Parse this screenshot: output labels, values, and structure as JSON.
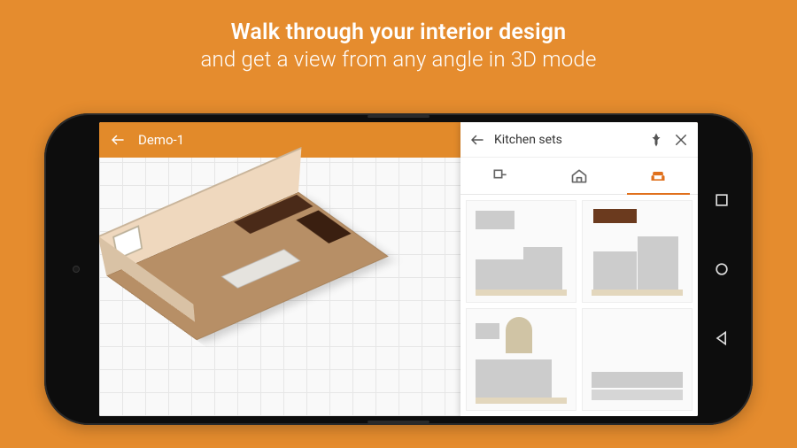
{
  "promo": {
    "line1": "Walk through your interior design",
    "line2": "and get a view from any angle in 3D mode"
  },
  "app": {
    "header": {
      "back_icon": "arrow-left",
      "title": "Demo-1"
    }
  },
  "panel": {
    "header": {
      "back_icon": "arrow-left",
      "title": "Kitchen sets",
      "pin_icon": "pin",
      "close_icon": "close"
    },
    "tabs": [
      {
        "id": "floorplan",
        "icon": "floorplan-icon",
        "active": false
      },
      {
        "id": "house",
        "icon": "house-icon",
        "active": false
      },
      {
        "id": "furniture",
        "icon": "sofa-icon",
        "active": true
      }
    ],
    "items": [
      {
        "id": "kitchen-set-green",
        "variant": "set-green"
      },
      {
        "id": "kitchen-set-dark",
        "variant": "set-dark"
      },
      {
        "id": "kitchen-set-cream",
        "variant": "set-cream"
      },
      {
        "id": "kitchen-set-white",
        "variant": "set-white"
      }
    ]
  },
  "system_buttons": [
    "recent",
    "home",
    "back"
  ],
  "colors": {
    "brand_orange": "#e58c2e",
    "accent": "#e0701c"
  }
}
